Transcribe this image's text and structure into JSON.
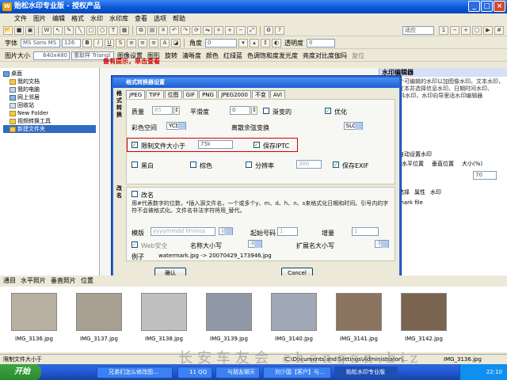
{
  "window": {
    "title": "贻松水印专业版 - 授权产品",
    "logo": "W",
    "controls": [
      "_",
      "□",
      "×"
    ]
  },
  "menu": [
    "文件",
    "图片",
    "编辑",
    "格式",
    "水印",
    "水印库",
    "查看",
    "选项",
    "帮助"
  ],
  "toolbar1": {
    "zoom_label": "适应"
  },
  "toolbar2": {
    "font_label": "字体",
    "font_value": "MS Sans MS",
    "size_value": "126",
    "angle_label": "角度",
    "angle_value": "0",
    "transparency_label": "透明度",
    "transparency_value": "0"
  },
  "toolbar3": {
    "image_size_label": "图片大小",
    "image_size_value": "640x480",
    "resize_value": "重取样 Triangl",
    "items": [
      "图像设置",
      "图形",
      "旋转",
      "清晰度",
      "颜色",
      "红绿蓝",
      "色调饱和度发光度",
      "亮度对比度伽玛",
      "复位"
    ],
    "preview_label": "预览"
  },
  "tabs_row": {
    "red_text": "备有提示，单击查看",
    "tabs": [
      "预览",
      "标注",
      "文图",
      "预览",
      "多窗控"
    ]
  },
  "tree": [
    "桌面",
    "我的文档",
    "我的电脑",
    "网上邻居",
    "回收站",
    "New Folder",
    "视频转换工具",
    "新建文件夹"
  ],
  "right_panel": {
    "title": "水印编辑器",
    "desc": "选择一个可编辑的水印以加图像水印。文本水印，并添加文本并选择信息水印、日期时间水印、EXIF资料水印，水印向导里适水印编辑器",
    "auto_title": "自动设置水印",
    "col1": "水平位置",
    "col2": "垂直位置",
    "col3": "大小(%)",
    "col3_value": "70",
    "tabs": [
      "选择",
      "属性",
      "水印"
    ],
    "file_label": "mark file"
  },
  "dialog": {
    "title": "格式转换器设置",
    "side_label": "格式转换",
    "rename_side": "改名",
    "tabs": [
      "JPEG",
      "TIFF",
      "位图",
      "GIF",
      "PNG",
      "JPEG2000",
      "不变",
      "AVI"
    ],
    "quality_label": "质量",
    "quality_value": "85",
    "smooth_label": "平滑度",
    "smooth_value": "0",
    "progressive_label": "渐变的",
    "optimize_label": "优化",
    "optimize_checked": true,
    "color_space_label": "彩色空间",
    "color_space_value": "YCbCr",
    "dct_label": "离散余弦变换",
    "dct_value": "SLOW",
    "limit_size_label": "限制文件大小于",
    "limit_size_checked": true,
    "limit_size_value": "75k",
    "keep_iptc_label": "保存IPTC",
    "keep_iptc_checked": true,
    "gray_label": "黑白",
    "gray_checked": false,
    "sepia_label": "棕色",
    "sepia_checked": false,
    "dpi_label": "分辨率",
    "dpi_checked": false,
    "dpi_value": "300",
    "keep_exif_label": "保存EXIF",
    "keep_exif_checked": true,
    "rename_label": "改名",
    "rename_checked": false,
    "rename_desc": "用#代表数字的位数，*插入源文件名，一个或多个y、m、d、h、n、s来格式化日期和时间。引号内的字符不会被格式化。文件名非法字符将用_替代。",
    "template_label": "模版",
    "template_value": "yyyymmdd hhnnss",
    "insert_label": "插入",
    "start_label": "起始号码",
    "start_value": "1",
    "step_label": "增量",
    "step_value": "1",
    "websafe_label": "Web安全",
    "websafe_checked": true,
    "name_case_label": "名称大小写",
    "name_case_value": "不变",
    "ext_case_label": "扩展名大小写",
    "ext_case_value": "不变",
    "example_label": "例子",
    "example_value": "watermark.jpg -> 20070429_173946.jpg",
    "ok_label": "确认",
    "cancel_label": "Cancel"
  },
  "bottom_tabs": [
    "通目",
    "水平照片",
    "垂直照片",
    "位置"
  ],
  "thumbs": [
    "IMG_3136.jpg",
    "IMG_3137.jpg",
    "IMG_3138.jpg",
    "IMG_3139.jpg",
    "IMG_3140.jpg",
    "IMG_3141.jpg",
    "IMG_3142.jpg"
  ],
  "status": {
    "left": "限制文件大小于",
    "path": "C:\\Documents and Settings\\Administrator\\...",
    "file": "IMG_3136.jpg"
  },
  "taskbar": {
    "start": "开始",
    "tasks": [
      "兄弟们怎么修改图...",
      "11 QQ",
      "与朋友聊天",
      "刘少国【客户】与...",
      "贻松水印专业版"
    ],
    "clock": "22:10"
  },
  "watermark": "长安车友会 changan.biz"
}
